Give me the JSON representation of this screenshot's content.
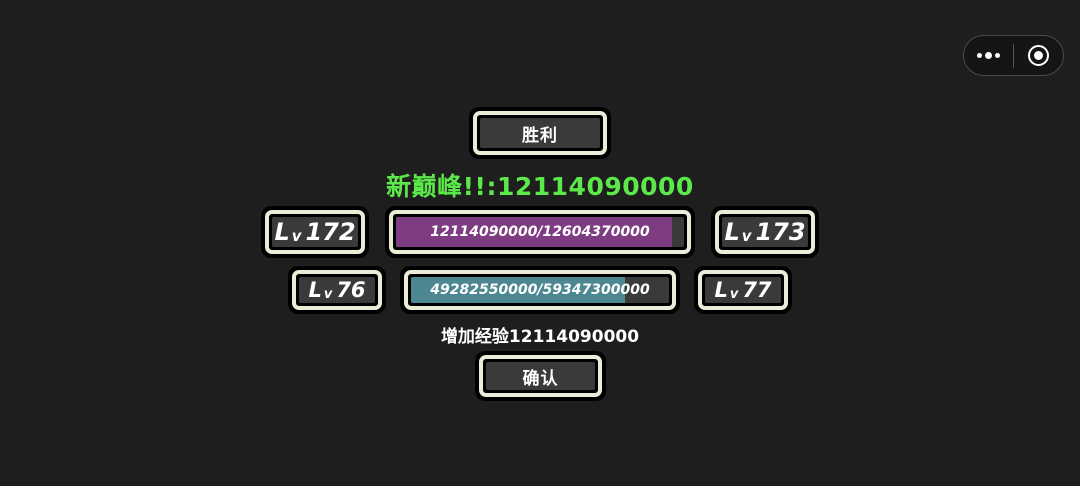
{
  "result_title": "胜利",
  "record_label": "新巅峰!!:",
  "record_value": "12114090000",
  "rows": [
    {
      "level_prefix": "L",
      "level_sub": "v",
      "level_current": "172",
      "level_next": "173",
      "xp_text": "12114090000/12604370000",
      "xp_progress": 0.96,
      "fill_color": "#7e3c82"
    },
    {
      "level_prefix": "L",
      "level_sub": "v",
      "level_current": "76",
      "level_next": "77",
      "xp_text": "49282550000/59347300000",
      "xp_progress": 0.83,
      "fill_color": "#4d8892"
    }
  ],
  "gain_text": "增加经验12114090000",
  "confirm_label": "确认",
  "capsule": {
    "menu_icon": "more-dots-icon",
    "close_icon": "target-icon"
  },
  "colors": {
    "background": "#1e1e1e",
    "frame": "#ecebd8",
    "panel": "#3a3a3a",
    "record": "#5ce84a"
  }
}
